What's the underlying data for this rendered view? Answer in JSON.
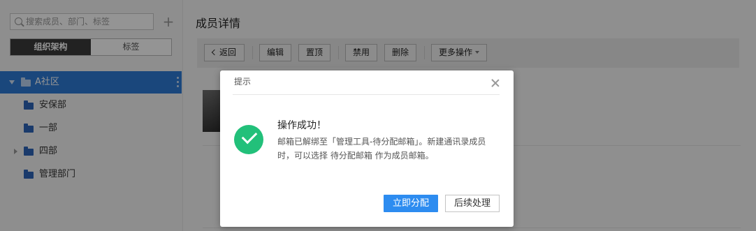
{
  "sidebar": {
    "search_placeholder": "搜索成员、部门、标签",
    "add_symbol": "+",
    "tabs": [
      {
        "label": "组织架构",
        "active": true
      },
      {
        "label": "标签",
        "active": false
      }
    ],
    "tree": {
      "root": "A社区",
      "items": [
        {
          "label": "安保部",
          "expandable": false
        },
        {
          "label": "一部",
          "expandable": false
        },
        {
          "label": "四部",
          "expandable": true
        },
        {
          "label": "管理部门",
          "expandable": false
        }
      ]
    }
  },
  "main": {
    "title": "成员详情",
    "toolbar": {
      "back": "返回",
      "edit": "编辑",
      "pin": "置顶",
      "disable": "禁用",
      "delete": "删除",
      "more": "更多操作"
    }
  },
  "dialog": {
    "title": "提示",
    "message_title": "操作成功！",
    "message_body": "邮箱已解绑至「管理工具-待分配邮箱」。新建通讯录成员时，可以选择 待分配邮箱 作为成员邮箱。",
    "primary_button": "立即分配",
    "secondary_button": "后续处理"
  },
  "colors": {
    "accent": "#2d7ad6",
    "primary_button": "#2d8cf0",
    "success": "#22c07a"
  }
}
